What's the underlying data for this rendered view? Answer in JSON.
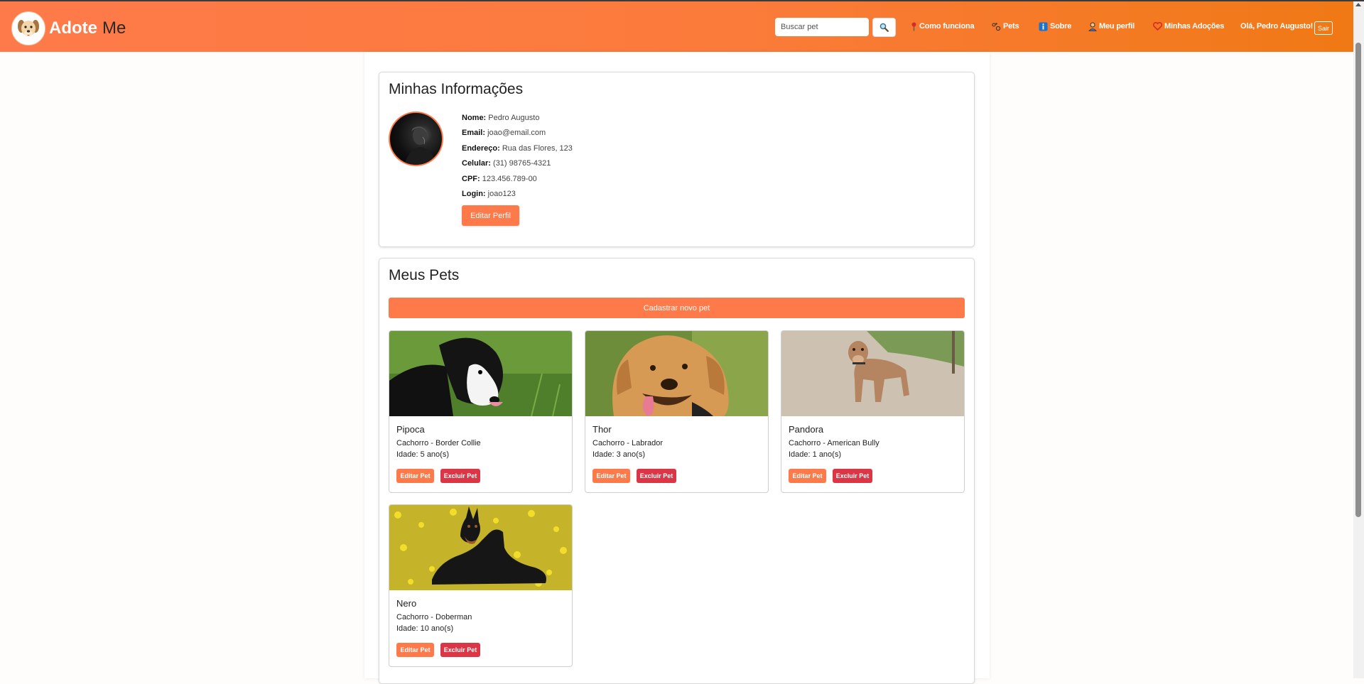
{
  "header": {
    "brand_bold": "Adote",
    "brand_rest": "Me",
    "search_placeholder": "Buscar pet",
    "nav": [
      {
        "label": "Como funciona",
        "icon": "pin-icon"
      },
      {
        "label": "Pets",
        "icon": "paw-icon"
      },
      {
        "label": "Sobre",
        "icon": "info-icon"
      },
      {
        "label": "Meu perfil",
        "icon": "user-icon"
      },
      {
        "label": "Minhas Adoções",
        "icon": "heart-icon"
      }
    ],
    "greeting": "Olá, Pedro Augusto!",
    "logout_label": "Sair"
  },
  "profile": {
    "title": "Minhas Informações",
    "fields": [
      {
        "label": "Nome:",
        "value": "Pedro Augusto"
      },
      {
        "label": "Email:",
        "value": "joao@email.com"
      },
      {
        "label": "Endereço:",
        "value": "Rua das Flores, 123"
      },
      {
        "label": "Celular:",
        "value": "(31) 98765-4321"
      },
      {
        "label": "CPF:",
        "value": "123.456.789-00"
      },
      {
        "label": "Login:",
        "value": "joao123"
      }
    ],
    "edit_label": "Editar Perfil"
  },
  "pets": {
    "title": "Meus Pets",
    "add_label": "Cadastrar novo pet",
    "edit_label": "Editar Pet",
    "delete_label": "Excluir Pet",
    "items": [
      {
        "name": "Pipoca",
        "species_breed": "Cachorro - Border Collie",
        "age": "Idade: 5 ano(s)"
      },
      {
        "name": "Thor",
        "species_breed": "Cachorro - Labrador",
        "age": "Idade: 3 ano(s)"
      },
      {
        "name": "Pandora",
        "species_breed": "Cachorro - American Bully",
        "age": "Idade: 1 ano(s)"
      },
      {
        "name": "Nero",
        "species_breed": "Cachorro - Doberman",
        "age": "Idade: 10 ano(s)"
      }
    ]
  },
  "colors": {
    "accent": "#ff7a4a",
    "header_end": "#f07915",
    "danger": "#dc3545"
  }
}
